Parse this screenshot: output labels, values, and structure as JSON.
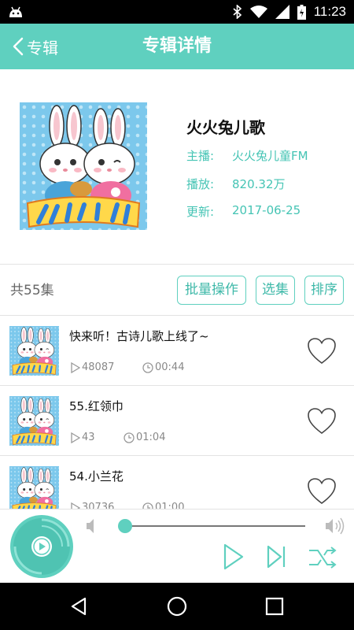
{
  "status_bar": {
    "time": "11:23"
  },
  "header": {
    "back_label": "专辑",
    "title": "专辑详情"
  },
  "album": {
    "title": "火火兔儿歌",
    "info": [
      {
        "key": "主播:",
        "value": "火火兔儿童FM"
      },
      {
        "key": "播放:",
        "value": "820.32万"
      },
      {
        "key": "更新:",
        "value": "2017-06-25"
      }
    ]
  },
  "toolbar": {
    "total": "共55集",
    "buttons": [
      "批量操作",
      "选集",
      "排序"
    ]
  },
  "tracks": [
    {
      "title": "快来听！古诗儿歌上线了~",
      "plays": "48087",
      "duration": "00:44"
    },
    {
      "title": "55.红领巾",
      "plays": "43",
      "duration": "01:04"
    },
    {
      "title": "54.小兰花",
      "plays": "30736",
      "duration": "01:00"
    }
  ],
  "player": {
    "progress": 0.0
  },
  "colors": {
    "accent": "#5fd0bf",
    "accent_text": "#45c4b4"
  },
  "icons": [
    "android-icon",
    "bluetooth-icon",
    "wifi-icon",
    "signal-icon",
    "battery-icon",
    "back-chevron-icon",
    "heart-icon",
    "play-count-icon",
    "clock-icon",
    "disc-icon",
    "volume-low-icon",
    "volume-high-icon",
    "play-icon",
    "next-icon",
    "shuffle-icon",
    "nav-back-icon",
    "nav-home-icon",
    "nav-recents-icon"
  ]
}
